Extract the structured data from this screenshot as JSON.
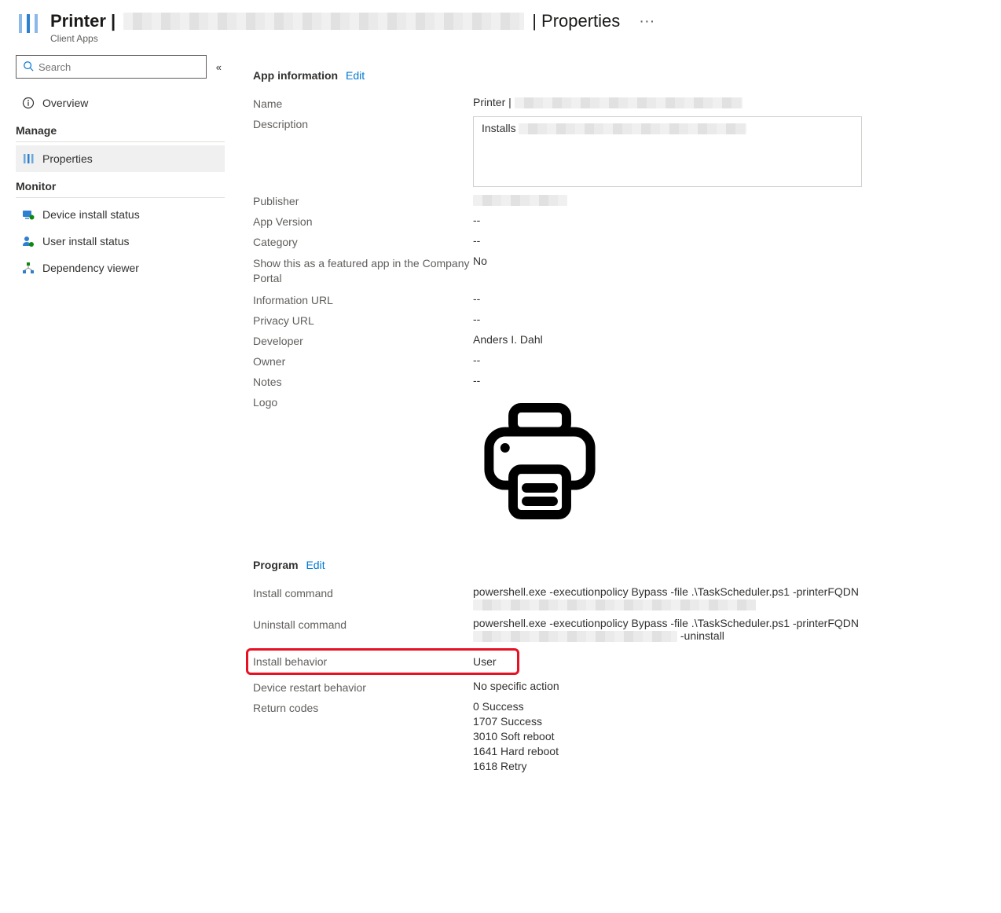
{
  "header": {
    "title_prefix": "Printer |",
    "title_suffix": "| Properties",
    "subtitle": "Client Apps",
    "more_actions_glyph": "···"
  },
  "sidebar": {
    "search_placeholder": "Search",
    "collapse_glyph": "«",
    "overview_label": "Overview",
    "group_manage": "Manage",
    "properties_label": "Properties",
    "group_monitor": "Monitor",
    "device_install_label": "Device install status",
    "user_install_label": "User install status",
    "dependency_viewer_label": "Dependency viewer"
  },
  "sections": {
    "app_info": {
      "heading": "App information",
      "edit": "Edit",
      "fields": {
        "name_label": "Name",
        "name_value_prefix": "Printer |",
        "description_label": "Description",
        "description_prefix": "Installs",
        "publisher_label": "Publisher",
        "app_version_label": "App Version",
        "app_version_value": "--",
        "category_label": "Category",
        "category_value": "--",
        "featured_label": "Show this as a featured app in the Company Portal",
        "featured_value": "No",
        "info_url_label": "Information URL",
        "info_url_value": "--",
        "privacy_url_label": "Privacy URL",
        "privacy_url_value": "--",
        "developer_label": "Developer",
        "developer_value": "Anders I. Dahl",
        "owner_label": "Owner",
        "owner_value": "--",
        "notes_label": "Notes",
        "notes_value": "--",
        "logo_label": "Logo"
      }
    },
    "program": {
      "heading": "Program",
      "edit": "Edit",
      "fields": {
        "install_cmd_label": "Install command",
        "install_cmd_value": "powershell.exe -executionpolicy Bypass -file .\\TaskScheduler.ps1 -printerFQDN",
        "uninstall_cmd_label": "Uninstall command",
        "uninstall_cmd_value": "powershell.exe -executionpolicy Bypass -file .\\TaskScheduler.ps1 -printerFQDN",
        "uninstall_cmd_suffix": "-uninstall",
        "install_behavior_label": "Install behavior",
        "install_behavior_value": "User",
        "restart_behavior_label": "Device restart behavior",
        "restart_behavior_value": "No specific action",
        "return_codes_label": "Return codes",
        "return_codes": [
          "0 Success",
          "1707 Success",
          "3010 Soft reboot",
          "1641 Hard reboot",
          "1618 Retry"
        ]
      }
    }
  }
}
